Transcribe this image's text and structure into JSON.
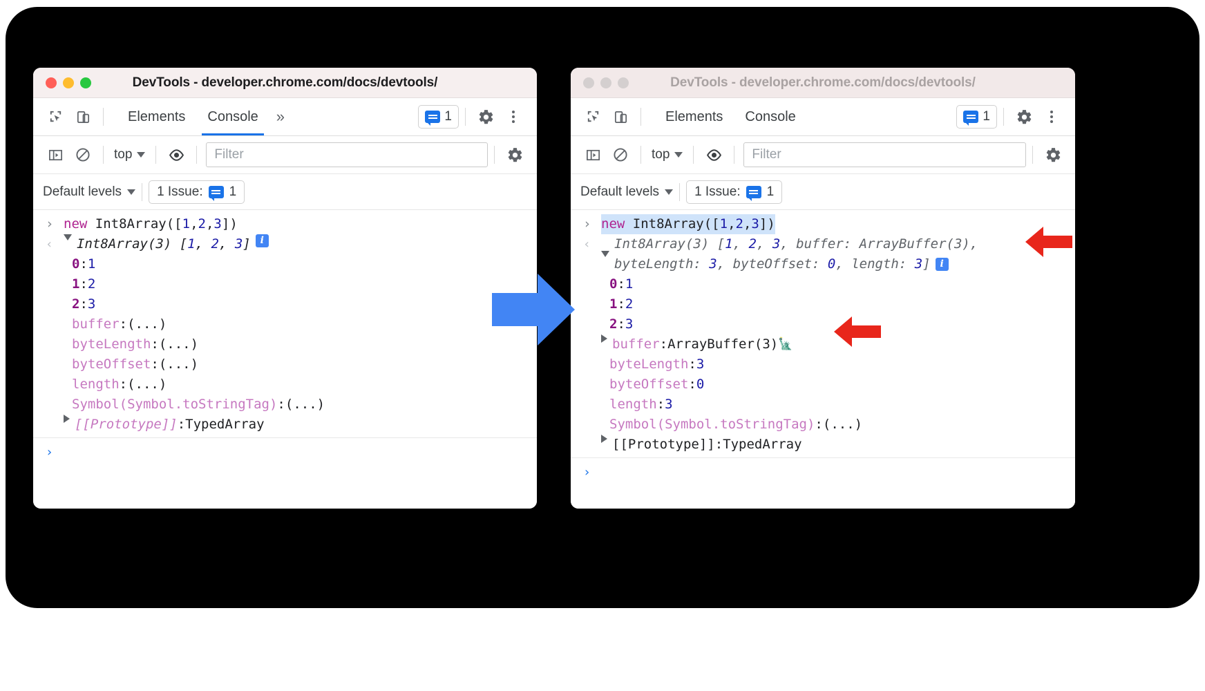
{
  "windows": {
    "left": {
      "title": "DevTools - developer.chrome.com/docs/devtools/",
      "tabs": [
        {
          "label": "Elements",
          "active": false
        },
        {
          "label": "Console",
          "active": true
        }
      ],
      "more_tabs_icon": "chevron-double-right-icon",
      "issues_count": "1",
      "toolbar": {
        "inspect_icon": "inspect-element-icon",
        "device_icon": "device-toolbar-icon",
        "settings_icon": "gear-icon",
        "kebab_icon": "more-options-icon"
      },
      "console_toolbar": {
        "sidebar_icon": "console-sidebar-icon",
        "clear_icon": "clear-console-icon",
        "context": "top",
        "eye_icon": "live-expression-icon",
        "filter_placeholder": "Filter",
        "settings_icon": "gear-icon"
      },
      "levels_bar": {
        "levels_label": "Default levels",
        "issue_label": "1 Issue:",
        "issue_count": "1"
      },
      "console": {
        "input_expr": {
          "kw": "new",
          "rest": " Int8Array([",
          "n1": "1",
          "c1": ",",
          "n2": "2",
          "c2": ",",
          "n3": "3",
          "close": "])"
        },
        "result_header": "Int8Array(3) [1, 2, 3]",
        "result_header_parts": {
          "name": "Int8Array(3) [",
          "v1": "1",
          "s1": ", ",
          "v2": "2",
          "s2": ", ",
          "v3": "3",
          "end": "]"
        },
        "rows": [
          {
            "key": "0",
            "sep": ": ",
            "value": "1",
            "kind": "index"
          },
          {
            "key": "1",
            "sep": ": ",
            "value": "2",
            "kind": "index"
          },
          {
            "key": "2",
            "sep": ": ",
            "value": "3",
            "kind": "index"
          },
          {
            "key": "buffer",
            "sep": ": ",
            "value": "(...)",
            "kind": "getter"
          },
          {
            "key": "byteLength",
            "sep": ": ",
            "value": "(...)",
            "kind": "getter"
          },
          {
            "key": "byteOffset",
            "sep": ": ",
            "value": "(...)",
            "kind": "getter"
          },
          {
            "key": "length",
            "sep": ": ",
            "value": "(...)",
            "kind": "getter"
          },
          {
            "key": "Symbol(Symbol.toStringTag)",
            "sep": ": ",
            "value": "(...)",
            "kind": "getter"
          }
        ],
        "prototype_key": "[[Prototype]]",
        "prototype_sep": ": ",
        "prototype_value": "TypedArray",
        "prompt_symbol": "›"
      }
    },
    "right": {
      "title": "DevTools - developer.chrome.com/docs/devtools/",
      "tabs": [
        {
          "label": "Elements",
          "active": false
        },
        {
          "label": "Console",
          "active": false
        }
      ],
      "issues_count": "1",
      "toolbar": {
        "inspect_icon": "inspect-element-icon",
        "device_icon": "device-toolbar-icon",
        "settings_icon": "gear-icon",
        "kebab_icon": "more-options-icon"
      },
      "console_toolbar": {
        "sidebar_icon": "console-sidebar-icon",
        "clear_icon": "clear-console-icon",
        "context": "top",
        "eye_icon": "live-expression-icon",
        "filter_placeholder": "Filter",
        "settings_icon": "gear-icon"
      },
      "levels_bar": {
        "levels_label": "Default levels",
        "issue_label": "1 Issue:",
        "issue_count": "1"
      },
      "console": {
        "input_expr": {
          "kw": "new",
          "rest": " Int8Array([",
          "n1": "1",
          "c1": ",",
          "n2": "2",
          "c2": ",",
          "n3": "3",
          "close": "])"
        },
        "result_line1": "Int8Array(3) [1, 2, 3, buffer: ArrayBuffer(3), b",
        "result_line2": "yteLength: 3, byteOffset: 0, length: 3]",
        "result_parts": {
          "a": "Int8Array(3) [",
          "v1": "1",
          "s1": ", ",
          "v2": "2",
          "s2": ", ",
          "v3": "3",
          "s3": ", buffer: ArrayBuffer(3), b",
          "b": "yteLength: ",
          "v4": "3",
          "c": ", byteOffset: ",
          "v5": "0",
          "d": ", length: ",
          "v6": "3",
          "e": "]"
        },
        "rows": [
          {
            "key": "0",
            "sep": ": ",
            "value": "1",
            "kind": "index"
          },
          {
            "key": "1",
            "sep": ": ",
            "value": "2",
            "kind": "index"
          },
          {
            "key": "2",
            "sep": ": ",
            "value": "3",
            "kind": "index"
          },
          {
            "key": "buffer",
            "sep": ": ",
            "value": "ArrayBuffer(3)",
            "kind": "object",
            "icon": "memory-chip-icon"
          },
          {
            "key": "byteLength",
            "sep": ": ",
            "value": "3",
            "kind": "number"
          },
          {
            "key": "byteOffset",
            "sep": ": ",
            "value": "0",
            "kind": "number"
          },
          {
            "key": "length",
            "sep": ": ",
            "value": "3",
            "kind": "number"
          },
          {
            "key": "Symbol(Symbol.toStringTag)",
            "sep": ": ",
            "value": "(...)",
            "kind": "getter"
          }
        ],
        "prototype_key": "[[Prototype]]",
        "prototype_sep": ": ",
        "prototype_value": "TypedArray",
        "prompt_symbol": "›"
      }
    }
  },
  "annotations": {
    "blue_arrow_icon": "blue-right-arrow",
    "red_arrow_1_icon": "red-left-arrow",
    "red_arrow_2_icon": "red-left-arrow"
  },
  "colors": {
    "accent_blue": "#1a73e8",
    "blue_arrow": "#4285f4",
    "red_arrow": "#e8261b",
    "titlebar_bg": "#f6efef",
    "keyword_magenta": "#af2390",
    "number_blue": "#1a1aa6",
    "property_pink": "#c678c0"
  }
}
